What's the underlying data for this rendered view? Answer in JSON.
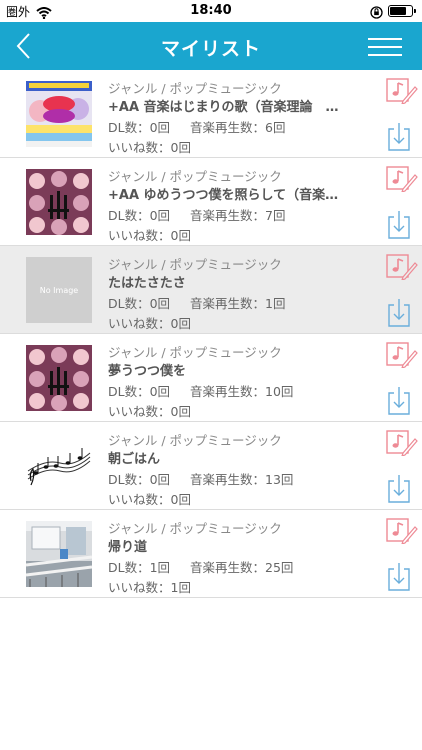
{
  "status_bar": {
    "carrier": "圏外",
    "time": "18:40"
  },
  "nav": {
    "title": "マイリスト"
  },
  "colors": {
    "nav_bg": "#1aa6cf",
    "edit_icon": "#ee8a95",
    "download_icon": "#6aaedb",
    "selected_row": "#ececec"
  },
  "songs": [
    {
      "genre": "ジャンル / ポップミュージック",
      "title": "+AA 音楽はじまりの歌（音楽理論　コード進行）",
      "dl": "DL数：0回",
      "plays": "音楽再生数：6回",
      "likes": "いいね数：0回",
      "thumbnail": "anime-poster"
    },
    {
      "genre": "ジャンル / ポップミュージック",
      "title": "+AA ゆめうつつ僕を照らして（音楽理論）",
      "dl": "DL数：0回",
      "plays": "音楽再生数：7回",
      "likes": "いいね数：0回",
      "thumbnail": "anime-collage"
    },
    {
      "genre": "ジャンル / ポップミュージック",
      "title": "たはたさたさ",
      "dl": "DL数：0回",
      "plays": "音楽再生数：1回",
      "likes": "いいね数：0回",
      "thumbnail": "no-image",
      "no_image_label": "No Image"
    },
    {
      "genre": "ジャンル / ポップミュージック",
      "title": "夢うつつ僕を",
      "dl": "DL数：0回",
      "plays": "音楽再生数：10回",
      "likes": "いいね数：0回",
      "thumbnail": "anime-collage"
    },
    {
      "genre": "ジャンル / ポップミュージック",
      "title": "朝ごはん",
      "dl": "DL数：0回",
      "plays": "音楽再生数：13回",
      "likes": "いいね数：0回",
      "thumbnail": "music-notes"
    },
    {
      "genre": "ジャンル / ポップミュージック",
      "title": "帰り道",
      "dl": "DL数：1回",
      "plays": "音楽再生数：25回",
      "likes": "いいね数：1回",
      "thumbnail": "classroom-photo"
    }
  ]
}
